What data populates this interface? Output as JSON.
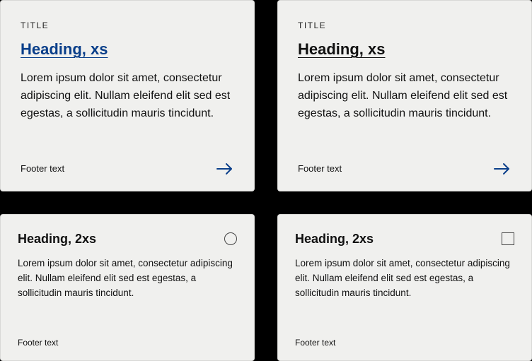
{
  "colors": {
    "accent": "#0a3f8a",
    "card_bg": "#f0f0ee",
    "card_border": "#d9d9d7",
    "text": "#111111"
  },
  "cards": [
    {
      "title": "TITLE",
      "heading": "Heading, xs",
      "heading_style": "link",
      "body": "Lorem ipsum dolor sit amet, consectetur adipiscing elit. Nullam eleifend elit sed est egestas, a sollicitudin mauris tincidunt.",
      "footer": "Footer text",
      "action_icon": "arrow-right"
    },
    {
      "title": "TITLE",
      "heading": "Heading, xs",
      "heading_style": "underline",
      "body": "Lorem ipsum dolor sit amet, consectetur adipiscing elit. Nullam eleifend elit sed est egestas, a sollicitudin mauris tincidunt.",
      "footer": "Footer text",
      "action_icon": "arrow-right"
    },
    {
      "heading": "Heading, 2xs",
      "control": "radio",
      "body": "Lorem ipsum dolor sit amet, consectetur adipiscing elit. Nullam eleifend elit sed est egestas, a sollicitudin mauris tincidunt.",
      "footer": "Footer text"
    },
    {
      "heading": "Heading, 2xs",
      "control": "checkbox",
      "body": "Lorem ipsum dolor sit amet, consectetur adipiscing elit. Nullam eleifend elit sed est egestas, a sollicitudin mauris tincidunt.",
      "footer": "Footer text"
    }
  ]
}
